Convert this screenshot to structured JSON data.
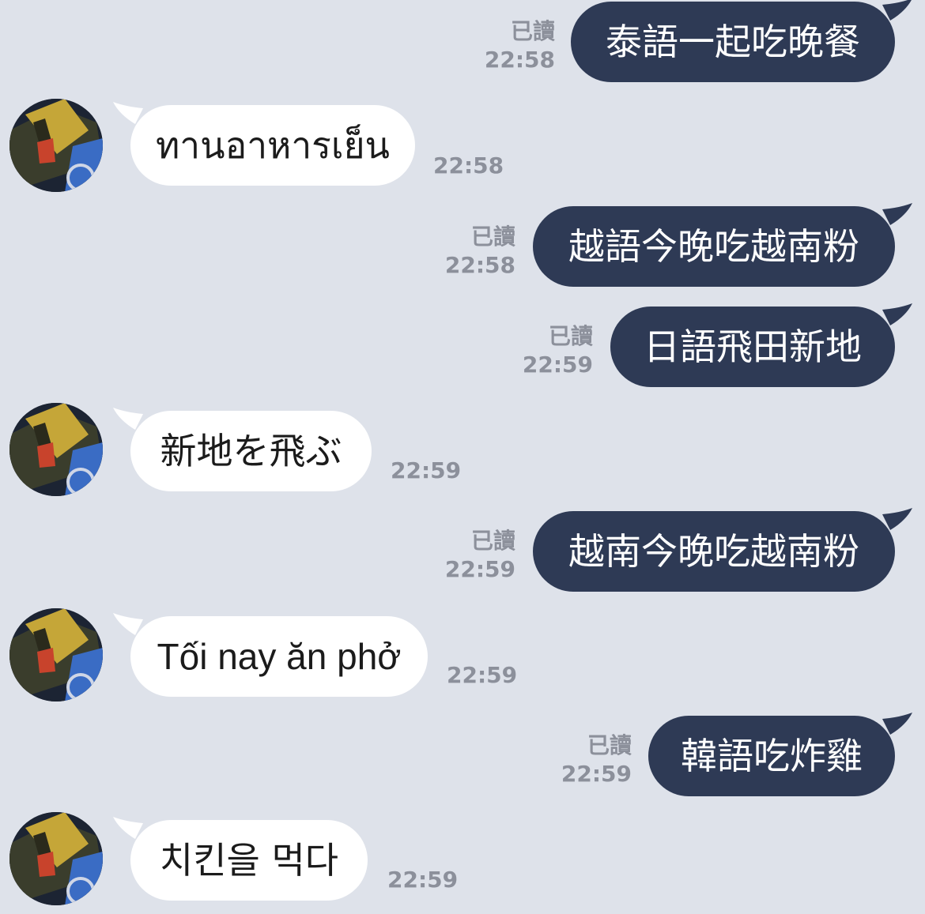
{
  "chat": {
    "messages": [
      {
        "id": "m1",
        "direction": "sent",
        "text": "泰語一起吃晚餐",
        "read": "已讀",
        "time": "22:58"
      },
      {
        "id": "m2",
        "direction": "received",
        "text": "ทานอาหารเย็น",
        "time": "22:58"
      },
      {
        "id": "m3",
        "direction": "sent",
        "text": "越語今晚吃越南粉",
        "read": "已讀",
        "time": "22:58"
      },
      {
        "id": "m4",
        "direction": "sent",
        "text": "日語飛田新地",
        "read": "已讀",
        "time": "22:59"
      },
      {
        "id": "m5",
        "direction": "received",
        "text": "新地を飛ぶ",
        "time": "22:59"
      },
      {
        "id": "m6",
        "direction": "sent",
        "text": "越南今晚吃越南粉",
        "read": "已讀",
        "time": "22:59"
      },
      {
        "id": "m7",
        "direction": "received",
        "text": "Tối nay ăn phở",
        "time": "22:59"
      },
      {
        "id": "m8",
        "direction": "sent",
        "text": "韓語吃炸雞",
        "read": "已讀",
        "time": "22:59"
      },
      {
        "id": "m9",
        "direction": "received",
        "text": "치킨을 먹다",
        "time": "22:59"
      }
    ]
  },
  "colors": {
    "background": "#dee2ea",
    "sent_bubble": "#2e3a55",
    "received_bubble": "#ffffff",
    "meta_text": "#8c909b"
  },
  "icons": {
    "avatar": "contact-avatar-image"
  }
}
